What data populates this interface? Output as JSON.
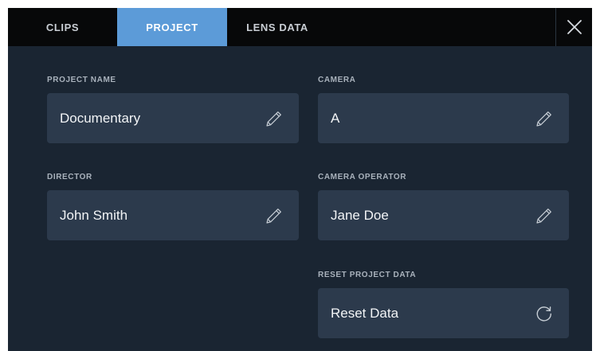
{
  "tabs": [
    {
      "label": "CLIPS",
      "active": false
    },
    {
      "label": "PROJECT",
      "active": true
    },
    {
      "label": "LENS DATA",
      "active": false
    }
  ],
  "close": {
    "icon": "close-icon"
  },
  "fields": {
    "project_name": {
      "label": "PROJECT NAME",
      "value": "Documentary",
      "icon": "pencil-icon"
    },
    "camera": {
      "label": "CAMERA",
      "value": "A",
      "icon": "pencil-icon"
    },
    "director": {
      "label": "DIRECTOR",
      "value": "John Smith",
      "icon": "pencil-icon"
    },
    "camera_operator": {
      "label": "CAMERA OPERATOR",
      "value": "Jane Doe",
      "icon": "pencil-icon"
    },
    "reset": {
      "label": "RESET PROJECT DATA",
      "value": "Reset Data",
      "icon": "reset-icon"
    }
  },
  "colors": {
    "background": "#1a2532",
    "tabbar": "#070809",
    "active_tab": "#5c9bd8",
    "field": "#2c3a4c",
    "label": "#a9b2bc",
    "value": "#f2f4f6"
  }
}
